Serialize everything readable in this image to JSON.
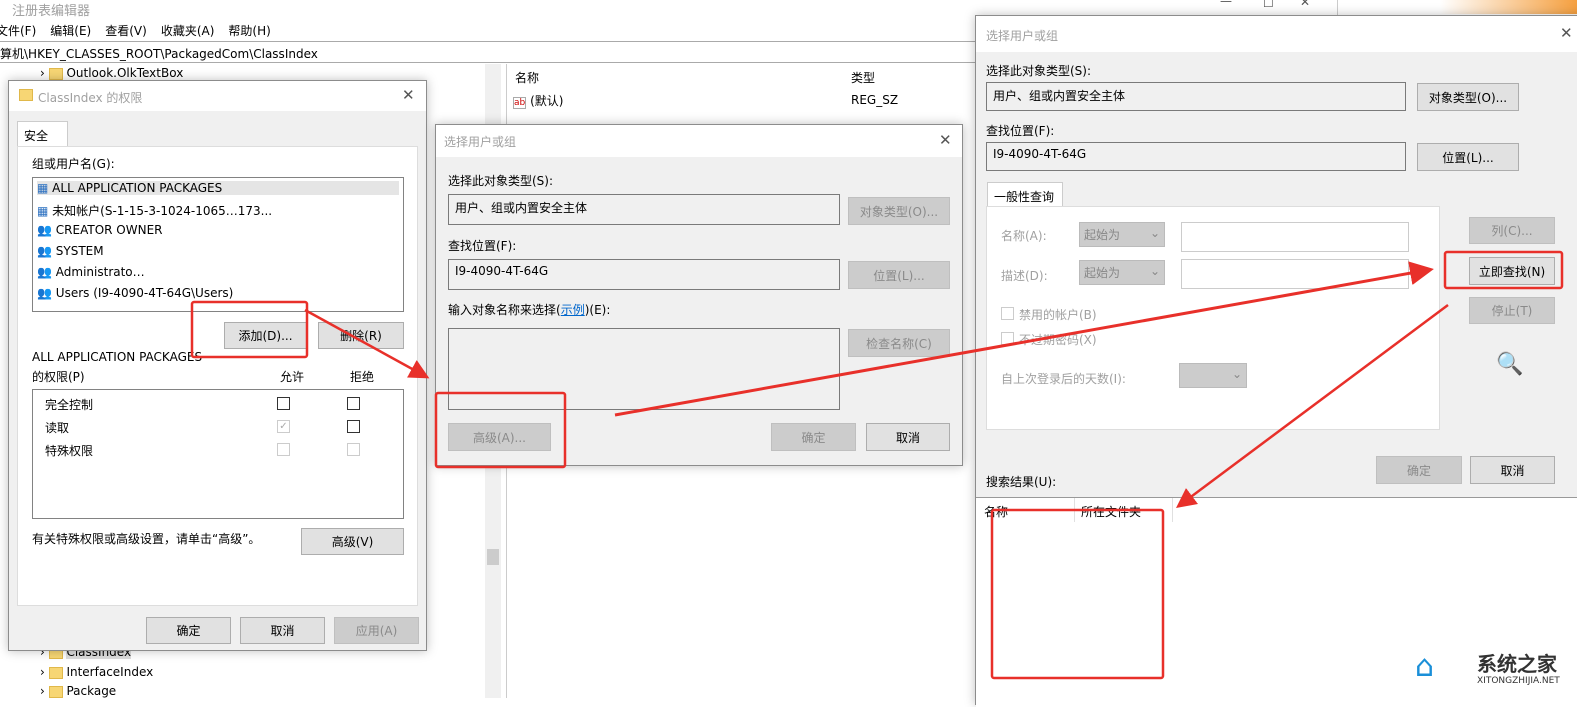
{
  "regedit": {
    "title": "注册表编辑器",
    "menu": [
      "文件(F)",
      "编辑(E)",
      "查看(V)",
      "收藏夹(A)",
      "帮助(H)"
    ],
    "address": "算机\\HKEY_CLASSES_ROOT\\PackagedCom\\ClassIndex",
    "tree": [
      "Outlook.OlkTextBox",
      "ClassIndex",
      "InterfaceIndex",
      "Package"
    ],
    "columns": [
      "名称",
      "类型"
    ],
    "rows": [
      {
        "name": "(默认)",
        "type": "REG_SZ"
      }
    ]
  },
  "perm": {
    "title": "ClassIndex 的权限",
    "tab": "安全",
    "group_label": "组或用户名(G):",
    "users": [
      "ALL APPLICATION PACKAGES",
      "未知帐户(S-1-15-3-1024-1065…173...",
      "CREATOR OWNER",
      "SYSTEM",
      "Administrato…",
      "Users (I9-4090-4T-64G\\Users)"
    ],
    "add": "添加(D)...",
    "remove": "删除(R)",
    "perm_for": "ALL APPLICATION PACKAGES",
    "perm_label": "的权限(P)",
    "allow": "允许",
    "deny": "拒绝",
    "perms": [
      {
        "name": "完全控制",
        "allow": false,
        "deny": false
      },
      {
        "name": "读取",
        "allow": true,
        "deny": false
      },
      {
        "name": "特殊权限",
        "allow": false,
        "deny": false
      }
    ],
    "hint": "有关特殊权限或高级设置，请单击“高级”。",
    "advanced": "高级(V)",
    "ok": "确定",
    "cancel": "取消",
    "apply": "应用(A)"
  },
  "sel1": {
    "title": "选择用户或组",
    "type_label": "选择此对象类型(S):",
    "type_value": "用户、组或内置安全主体",
    "type_btn": "对象类型(O)...",
    "loc_label": "查找位置(F):",
    "loc_value": "I9-4090-4T-64G",
    "loc_btn": "位置(L)...",
    "enter_label": "输入对象名称来选择(",
    "example": "示例",
    "enter_suffix": ")(E):",
    "check": "检查名称(C)",
    "advanced": "高级(A)...",
    "ok": "确定",
    "cancel": "取消"
  },
  "sel2": {
    "title": "选择用户或组",
    "type_label": "选择此对象类型(S):",
    "type_value": "用户、组或内置安全主体",
    "type_btn": "对象类型(O)...",
    "loc_label": "查找位置(F):",
    "loc_value": "I9-4090-4T-64G",
    "loc_btn": "位置(L)...",
    "tab": "一般性查询",
    "name_label": "名称(A):",
    "desc_label": "描述(D):",
    "starts_with": "起始为",
    "disabled_acc": "禁用的帐户(B)",
    "no_expire": "不过期密码(X)",
    "days_label": "自上次登录后的天数(I):",
    "columns_btn": "列(C)...",
    "find_now": "立即查找(N)",
    "stop": "停止(T)",
    "ok": "确定",
    "cancel": "取消",
    "results_label": "搜索结果(U):",
    "result_cols": [
      "名称",
      "所在文件夹"
    ]
  },
  "watermark": {
    "cn": "系统之家",
    "en": "XITONGZHIJIA.NET"
  },
  "colors": {
    "annotation": "#e8302a",
    "link": "#0066cc"
  }
}
